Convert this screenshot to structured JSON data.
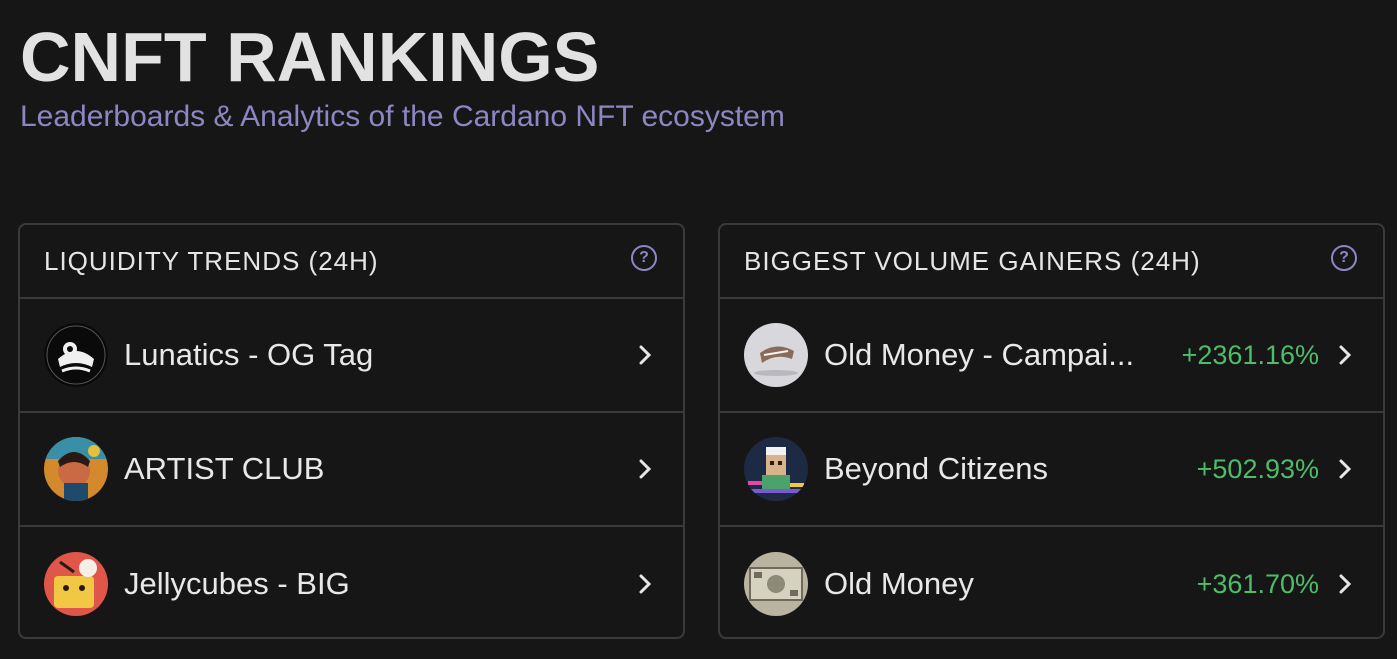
{
  "header": {
    "title": "CNFT RANKINGS",
    "subtitle": "Leaderboards & Analytics of the Cardano NFT ecosystem"
  },
  "colors": {
    "background": "#161616",
    "accent": "#8c87c2",
    "positive": "#4ebd6a",
    "border": "#3a3a3a"
  },
  "liquidity": {
    "title": "LIQUIDITY TRENDS (24H)",
    "help_icon": "question-circle-icon",
    "items": [
      {
        "label": "Lunatics - OG Tag"
      },
      {
        "label": "ARTIST CLUB"
      },
      {
        "label": "Jellycubes - BIG"
      }
    ]
  },
  "gainers": {
    "title": "BIGGEST VOLUME GAINERS (24H)",
    "help_icon": "question-circle-icon",
    "items": [
      {
        "label": "Old Money - Campai...",
        "change": "+2361.16%"
      },
      {
        "label": "Beyond Citizens",
        "change": "+502.93%"
      },
      {
        "label": "Old Money",
        "change": "+361.70%"
      }
    ]
  }
}
